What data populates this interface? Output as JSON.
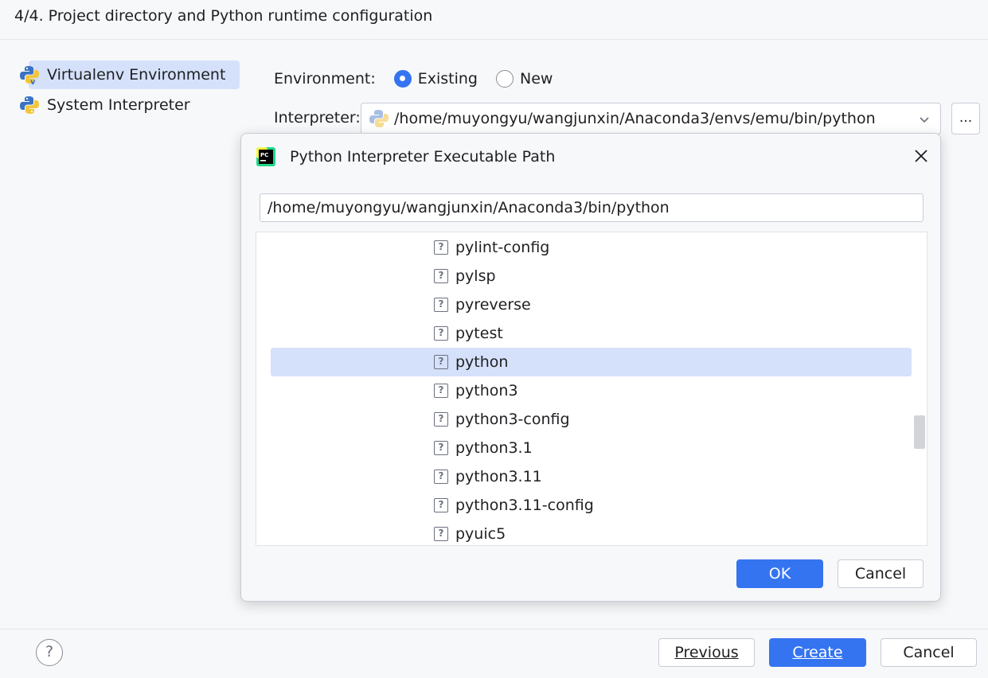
{
  "header": {
    "title": "4/4. Project directory and Python runtime configuration"
  },
  "sidebar": {
    "items": [
      {
        "label": "Virtualenv Environment",
        "icon": "virtualenv-icon",
        "selected": true
      },
      {
        "label": "System Interpreter",
        "icon": "python-icon",
        "selected": false
      }
    ]
  },
  "environment": {
    "label": "Environment:",
    "options": [
      {
        "label": "Existing",
        "checked": true
      },
      {
        "label": "New",
        "checked": false
      }
    ]
  },
  "interpreter": {
    "label": "Interpreter:",
    "value": "/home/muyongyu/wangjunxin/Anaconda3/envs/emu/bin/python",
    "browse_label": "..."
  },
  "dialog": {
    "title": "Python Interpreter Executable Path",
    "path": "/home/muyongyu/wangjunxin/Anaconda3/bin/python",
    "files": [
      {
        "name": "pylint-config",
        "selected": false
      },
      {
        "name": "pylsp",
        "selected": false
      },
      {
        "name": "pyreverse",
        "selected": false
      },
      {
        "name": "pytest",
        "selected": false
      },
      {
        "name": "python",
        "selected": true
      },
      {
        "name": "python3",
        "selected": false
      },
      {
        "name": "python3-config",
        "selected": false
      },
      {
        "name": "python3.1",
        "selected": false
      },
      {
        "name": "python3.11",
        "selected": false
      },
      {
        "name": "python3.11-config",
        "selected": false
      },
      {
        "name": "pyuic5",
        "selected": false
      }
    ],
    "file_icon_glyph": "?",
    "ok_label": "OK",
    "cancel_label": "Cancel"
  },
  "footer": {
    "help_label": "?",
    "previous_label": "Previous",
    "create_label": "Create",
    "cancel_label": "Cancel"
  },
  "colors": {
    "accent": "#3574f0",
    "selection": "#d5e1fa",
    "background": "#f7f8fa"
  }
}
